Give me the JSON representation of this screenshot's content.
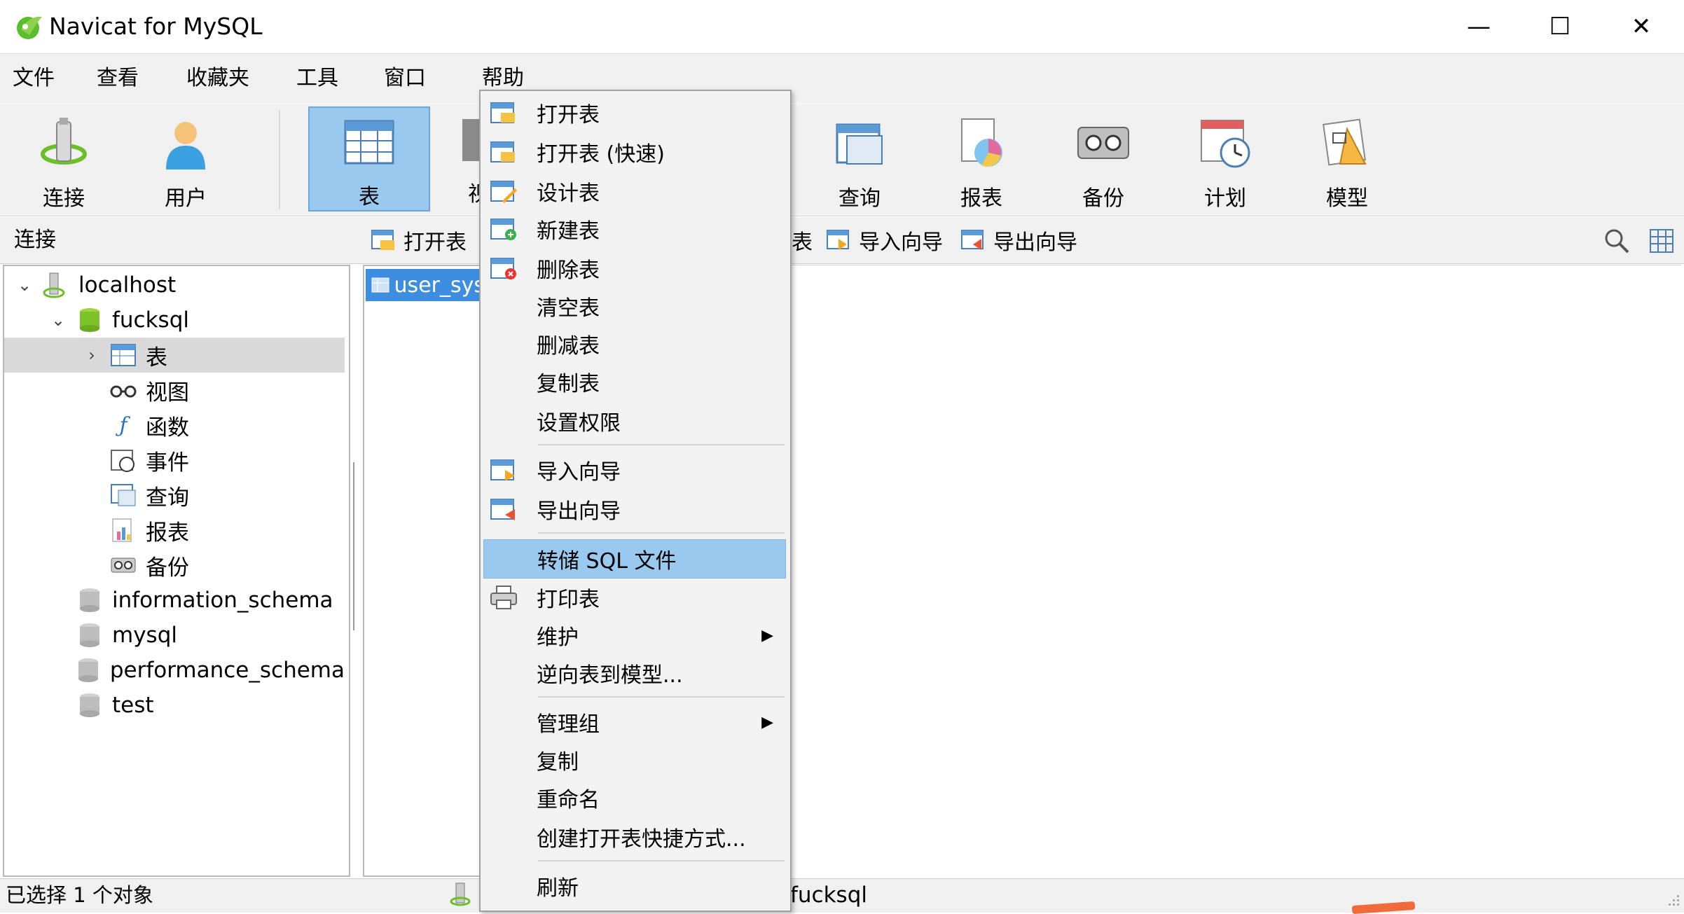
{
  "window": {
    "title": "Navicat for MySQL",
    "minimize": "—",
    "maximize": "☐",
    "close": "✕"
  },
  "menubar": [
    "文件",
    "查看",
    "收藏夹",
    "工具",
    "窗口",
    "帮助"
  ],
  "toolbar": {
    "connect": "连接",
    "user": "用户",
    "table": "表",
    "view_partial": "视",
    "query": "查询",
    "report": "报表",
    "backup": "备份",
    "schedule": "计划",
    "model": "模型"
  },
  "objbar": {
    "connection_label": "连接",
    "open_table": "打开表",
    "partial_table": "表",
    "import_wizard": "导入向导",
    "export_wizard": "导出向导"
  },
  "tree": {
    "host": "localhost",
    "db": "fucksql",
    "children": [
      "表",
      "视图",
      "函数",
      "事件",
      "查询",
      "报表",
      "备份"
    ],
    "other_dbs": [
      "information_schema",
      "mysql",
      "performance_schema",
      "test"
    ]
  },
  "objlist": {
    "selected_item": "user_sys"
  },
  "context_menu": [
    {
      "label": "打开表"
    },
    {
      "label": "打开表 (快速)"
    },
    {
      "label": "设计表"
    },
    {
      "label": "新建表"
    },
    {
      "label": "删除表"
    },
    {
      "label": "清空表"
    },
    {
      "label": "删减表"
    },
    {
      "label": "复制表"
    },
    {
      "label": "设置权限"
    },
    {
      "label": "导入向导"
    },
    {
      "label": "导出向导"
    },
    {
      "label": "转储 SQL 文件"
    },
    {
      "label": "打印表"
    },
    {
      "label": "维护"
    },
    {
      "label": "逆向表到模型..."
    },
    {
      "label": "管理组"
    },
    {
      "label": "复制"
    },
    {
      "label": "重命名"
    },
    {
      "label": "创建打开表快捷方式..."
    },
    {
      "label": "刷新"
    }
  ],
  "status": {
    "selection": "已选择 1 个对象",
    "connection": "fucksql"
  },
  "colors": {
    "highlight": "#99c9ef",
    "selected_item": "#3d8ee0",
    "chrome": "#f0f0f0"
  }
}
